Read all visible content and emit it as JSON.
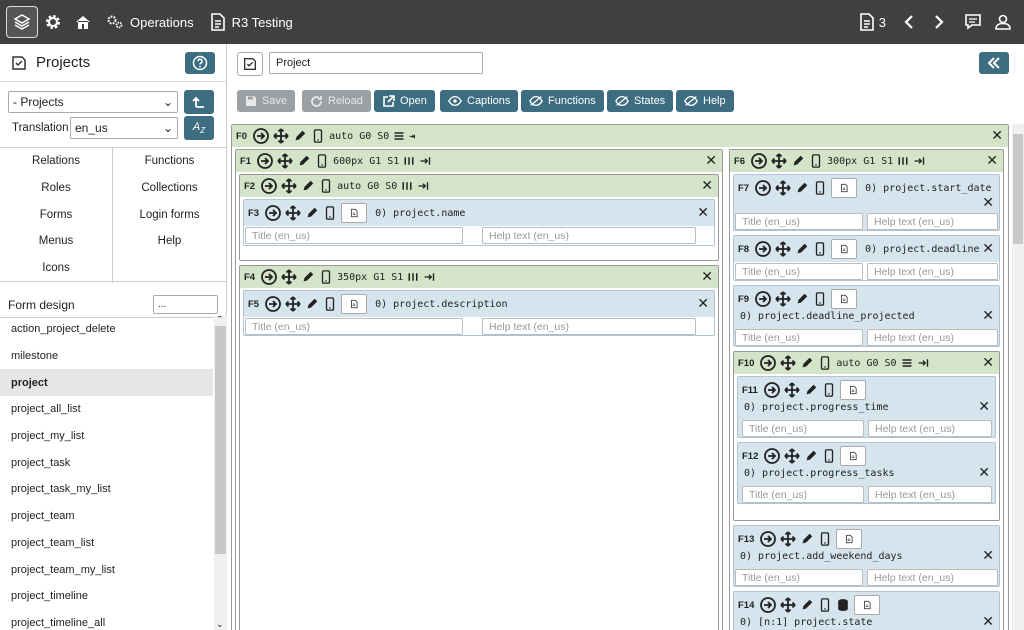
{
  "topbar": {
    "items": [
      {
        "label": "Operations"
      },
      {
        "label": "R3 Testing"
      }
    ],
    "count": "3"
  },
  "sidebar": {
    "title": "Projects",
    "module_select": "- Projects",
    "translation_label": "Translation",
    "translation_value": "en_us",
    "menu_left": [
      "Relations",
      "Roles",
      "Forms",
      "Menus",
      "Icons"
    ],
    "menu_right": [
      "Functions",
      "Collections",
      "Login forms",
      "Help"
    ],
    "form_design_label": "Form design",
    "form_design_filter": "...",
    "forms": [
      "action_project_delete",
      "milestone",
      "project",
      "project_all_list",
      "project_my_list",
      "project_task",
      "project_task_my_list",
      "project_team",
      "project_team_list",
      "project_team_my_list",
      "project_timeline",
      "project_timeline_all"
    ],
    "active_form": "project"
  },
  "main": {
    "form_name": "Project",
    "toolbar": {
      "save": "Save",
      "reload": "Reload",
      "open": "Open",
      "captions": "Captions",
      "functions": "Functions",
      "states": "States",
      "help": "Help"
    },
    "title_placeholder": "Title (en_us)",
    "help_placeholder": "Help text (en_us)",
    "fields": {
      "f0": {
        "id": "F0",
        "meta": "auto G0 S0"
      },
      "f1": {
        "id": "F1",
        "meta": "600px G1 S1"
      },
      "f2": {
        "id": "F2",
        "meta": "auto G0 S0"
      },
      "f3": {
        "id": "F3",
        "attr": "0) project.name"
      },
      "f4": {
        "id": "F4",
        "meta": "350px G1 S1"
      },
      "f5": {
        "id": "F5",
        "attr": "0) project.description"
      },
      "f6": {
        "id": "F6",
        "meta": "300px G1 S1"
      },
      "f7": {
        "id": "F7",
        "attr": "0) project.start_date"
      },
      "f8": {
        "id": "F8",
        "attr": "0) project.deadline"
      },
      "f9": {
        "id": "F9",
        "attr": "0) project.deadline_projected"
      },
      "f10": {
        "id": "F10",
        "meta": "auto G0 S0"
      },
      "f11": {
        "id": "F11",
        "attr": "0) project.progress_time"
      },
      "f12": {
        "id": "F12",
        "attr": "0) project.progress_tasks"
      },
      "f13": {
        "id": "F13",
        "attr": "0) project.add_weekend_days"
      },
      "f14": {
        "id": "F14",
        "attr": "0) [n:1] project.state"
      }
    }
  }
}
